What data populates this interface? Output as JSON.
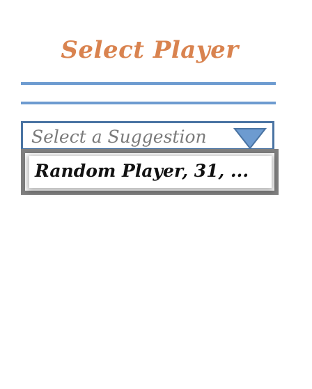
{
  "header": {
    "title": "Select Player"
  },
  "select": {
    "placeholder": "Select a Suggestion",
    "arrow_icon": "triangle-down-icon",
    "border_color": "#4a74a3"
  },
  "suggestions": [
    {
      "label": "Random Player, 31, ..."
    }
  ],
  "colors": {
    "title": "#d9834f",
    "rule": "#6d9bd0",
    "arrow_fill": "#6d9bd0",
    "list_border": "#7f7f7f"
  }
}
